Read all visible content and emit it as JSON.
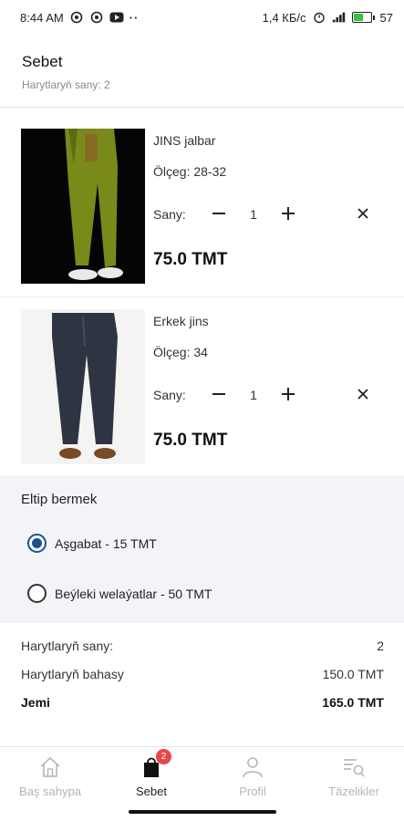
{
  "status_bar": {
    "time": "8:44 AM",
    "speed": "1,4 КБ/с",
    "battery_percent": "57",
    "battery_level": 0.57,
    "icons": [
      "whatsapp-icon",
      "whatsapp-icon",
      "youtube-icon",
      "more-dots-icon",
      "alarm-icon",
      "signal-icon",
      "battery-icon"
    ]
  },
  "header": {
    "title": "Sebet",
    "subtitle": "Harytlaryň sany: 2"
  },
  "cart": {
    "items": [
      {
        "name": "JINS jalbar",
        "size": "Ölçeg: 28-32",
        "qty_label": "Sany:",
        "qty": "1",
        "price": "75.0 TMT"
      },
      {
        "name": "Erkek jins",
        "size": "Ölçeg: 34",
        "qty_label": "Sany:",
        "qty": "1",
        "price": "75.0 TMT"
      }
    ]
  },
  "delivery": {
    "title": "Eltip bermek",
    "options": [
      {
        "label": "Aşgabat - 15 TMT",
        "selected": true
      },
      {
        "label": "Beýleki welaýatlar - 50 TMT",
        "selected": false
      }
    ]
  },
  "summary": {
    "rows": [
      {
        "label": "Harytlaryň sany:",
        "value": "2"
      },
      {
        "label": "Harytlaryň bahasy",
        "value": "150.0 TMT"
      }
    ],
    "total_label": "Jemi",
    "total_value": "165.0 TMT"
  },
  "nav": {
    "items": [
      {
        "label": "Baş sahypa",
        "icon": "home-icon"
      },
      {
        "label": "Sebet",
        "icon": "shopping-bag-icon",
        "badge": "2"
      },
      {
        "label": "Profil",
        "icon": "user-icon"
      },
      {
        "label": "Täzelikler",
        "icon": "news-search-icon"
      }
    ]
  },
  "colors": {
    "accent": "#1d4e8f",
    "badge": "#e5484d",
    "delivery_bg": "#f3f4f7",
    "inactive_nav": "#b5b5b5"
  }
}
